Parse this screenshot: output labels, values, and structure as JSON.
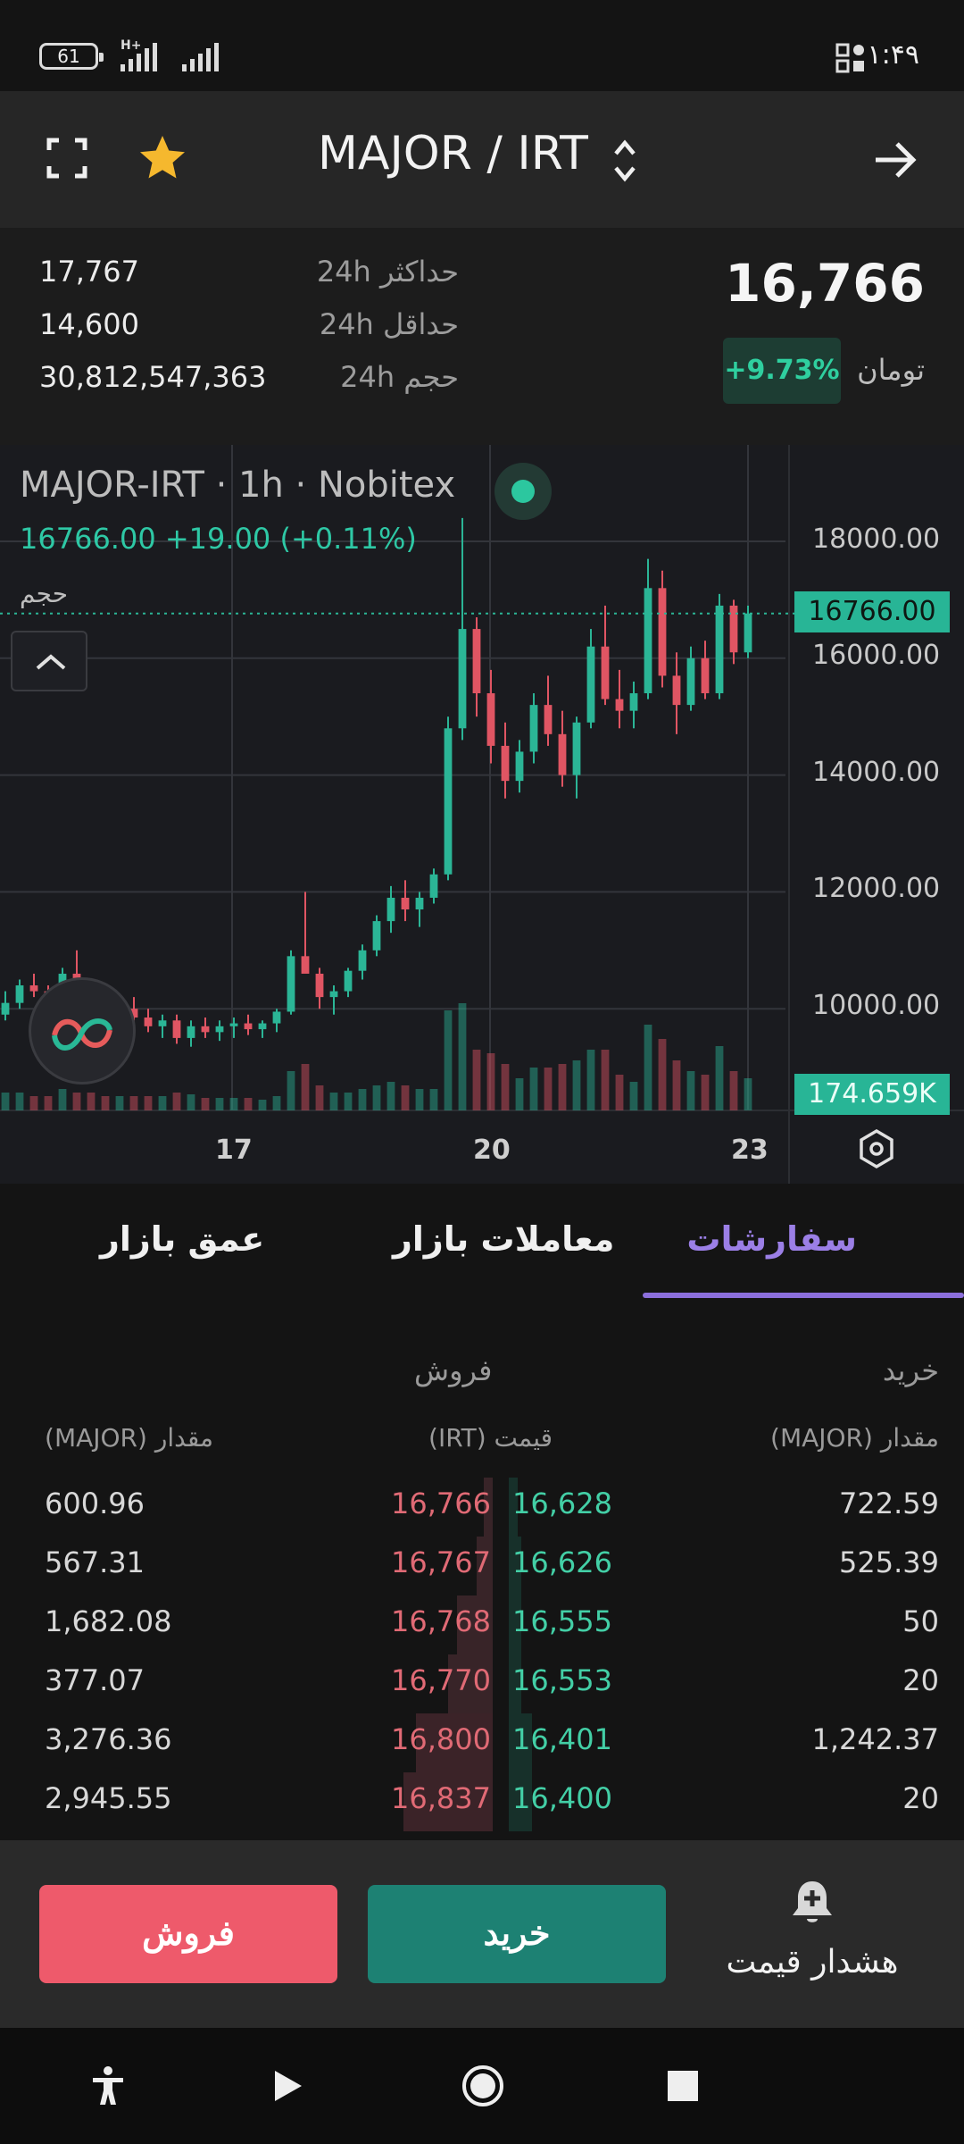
{
  "status_bar": {
    "battery": "61",
    "network": "H+",
    "time": "۱:۴۹"
  },
  "header": {
    "title": "MAJOR / IRT"
  },
  "summary": {
    "price": "16,766",
    "currency": "تومان",
    "change": "+9.73%",
    "change_color": "#2fcf9f",
    "stats": [
      {
        "label": "حداکثر 24h",
        "value": "17,767"
      },
      {
        "label": "حداقل 24h",
        "value": "14,600"
      },
      {
        "label": "حجم 24h",
        "value": "30,812,547,363"
      }
    ]
  },
  "chart": {
    "symbol_line": "MAJOR-IRT · 1h · Nobitex",
    "quote_line": "16766.00  +19.00 (+0.11%)",
    "volume_label": "حجم",
    "last_price_tag": "16766.00",
    "volume_tag": "174.659K",
    "up_color": "#2bb596",
    "down_color": "#e05563"
  },
  "chart_data": {
    "type": "candlestick",
    "ylim": [
      9000,
      19000
    ],
    "y_ticks": [
      "18000.00",
      "16000.00",
      "14000.00",
      "12000.00",
      "10000.00"
    ],
    "x_ticks": [
      "17",
      "20",
      "23"
    ],
    "last_price": 16766,
    "series": [
      {
        "values": [
          [
            9900,
            10300,
            9800,
            10100
          ],
          [
            10100,
            10500,
            10000,
            10400
          ],
          [
            10400,
            10600,
            10200,
            10300
          ],
          [
            10300,
            10400,
            10000,
            10150
          ],
          [
            10150,
            10700,
            10100,
            10600
          ],
          [
            10600,
            11000,
            10500,
            10450
          ],
          [
            10450,
            10500,
            10000,
            10050
          ],
          [
            10050,
            10200,
            9800,
            9900
          ],
          [
            9900,
            10100,
            9700,
            10000
          ],
          [
            10000,
            10200,
            9800,
            9850
          ],
          [
            9850,
            10000,
            9600,
            9700
          ],
          [
            9700,
            9900,
            9500,
            9800
          ],
          [
            9800,
            9900,
            9400,
            9500
          ],
          [
            9500,
            9800,
            9350,
            9700
          ],
          [
            9700,
            9850,
            9500,
            9600
          ],
          [
            9600,
            9800,
            9450,
            9700
          ],
          [
            9700,
            9850,
            9500,
            9750
          ],
          [
            9750,
            9900,
            9550,
            9650
          ],
          [
            9650,
            9800,
            9500,
            9750
          ],
          [
            9750,
            10000,
            9600,
            9950
          ],
          [
            9950,
            11000,
            9900,
            10900
          ],
          [
            10900,
            12000,
            10700,
            10600
          ],
          [
            10600,
            10700,
            10000,
            10200
          ],
          [
            10200,
            10400,
            9900,
            10300
          ],
          [
            10300,
            10700,
            10200,
            10650
          ],
          [
            10650,
            11100,
            10500,
            11000
          ],
          [
            11000,
            11600,
            10900,
            11500
          ],
          [
            11500,
            12100,
            11300,
            11900
          ],
          [
            11900,
            12200,
            11500,
            11700
          ],
          [
            11700,
            12000,
            11400,
            11900
          ],
          [
            11900,
            12400,
            11800,
            12300
          ],
          [
            12300,
            15000,
            12200,
            14800
          ],
          [
            14800,
            18400,
            14600,
            16500
          ],
          [
            16500,
            16700,
            15000,
            15400
          ],
          [
            15400,
            15800,
            14200,
            14500
          ],
          [
            14500,
            14900,
            13600,
            13900
          ],
          [
            13900,
            14600,
            13700,
            14400
          ],
          [
            14400,
            15400,
            14200,
            15200
          ],
          [
            15200,
            15700,
            14500,
            14700
          ],
          [
            14700,
            15100,
            13800,
            14000
          ],
          [
            14000,
            15000,
            13600,
            14900
          ],
          [
            14900,
            16500,
            14800,
            16200
          ],
          [
            16200,
            16900,
            15200,
            15300
          ],
          [
            15300,
            15800,
            14800,
            15100
          ],
          [
            15100,
            15600,
            14800,
            15400
          ],
          [
            15400,
            17700,
            15300,
            17200
          ],
          [
            17200,
            17500,
            15500,
            15700
          ],
          [
            15700,
            16100,
            14700,
            15200
          ],
          [
            15200,
            16200,
            15100,
            16000
          ],
          [
            16000,
            16300,
            15300,
            15400
          ],
          [
            15400,
            17100,
            15300,
            16900
          ],
          [
            16900,
            17000,
            15900,
            16100
          ],
          [
            16100,
            16900,
            16000,
            16766
          ]
        ]
      }
    ]
  },
  "tabs": [
    {
      "label": "سفارشات",
      "active": true
    },
    {
      "label": "معاملات بازار",
      "active": false
    },
    {
      "label": "عمق بازار",
      "active": false
    }
  ],
  "orderbook": {
    "buy_title": "خرید",
    "sell_title": "فروش",
    "col_buy_amount": "مقدار (MAJOR)",
    "col_price": "قیمت (IRT)",
    "col_sell_amount": "مقدار (MAJOR)",
    "rows": [
      {
        "sell_amount": "600.96",
        "sell_price": "16,766",
        "buy_price": "16,628",
        "buy_amount": "722.59"
      },
      {
        "sell_amount": "567.31",
        "sell_price": "16,767",
        "buy_price": "16,626",
        "buy_amount": "525.39"
      },
      {
        "sell_amount": "1,682.08",
        "sell_price": "16,768",
        "buy_price": "16,555",
        "buy_amount": "50"
      },
      {
        "sell_amount": "377.07",
        "sell_price": "16,770",
        "buy_price": "16,553",
        "buy_amount": "20"
      },
      {
        "sell_amount": "3,276.36",
        "sell_price": "16,800",
        "buy_price": "16,401",
        "buy_amount": "1,242.37"
      },
      {
        "sell_amount": "2,945.55",
        "sell_price": "16,837",
        "buy_price": "16,400",
        "buy_amount": "20"
      }
    ]
  },
  "actions": {
    "sell": "فروش",
    "buy": "خرید",
    "alert": "هشدار قیمت"
  }
}
